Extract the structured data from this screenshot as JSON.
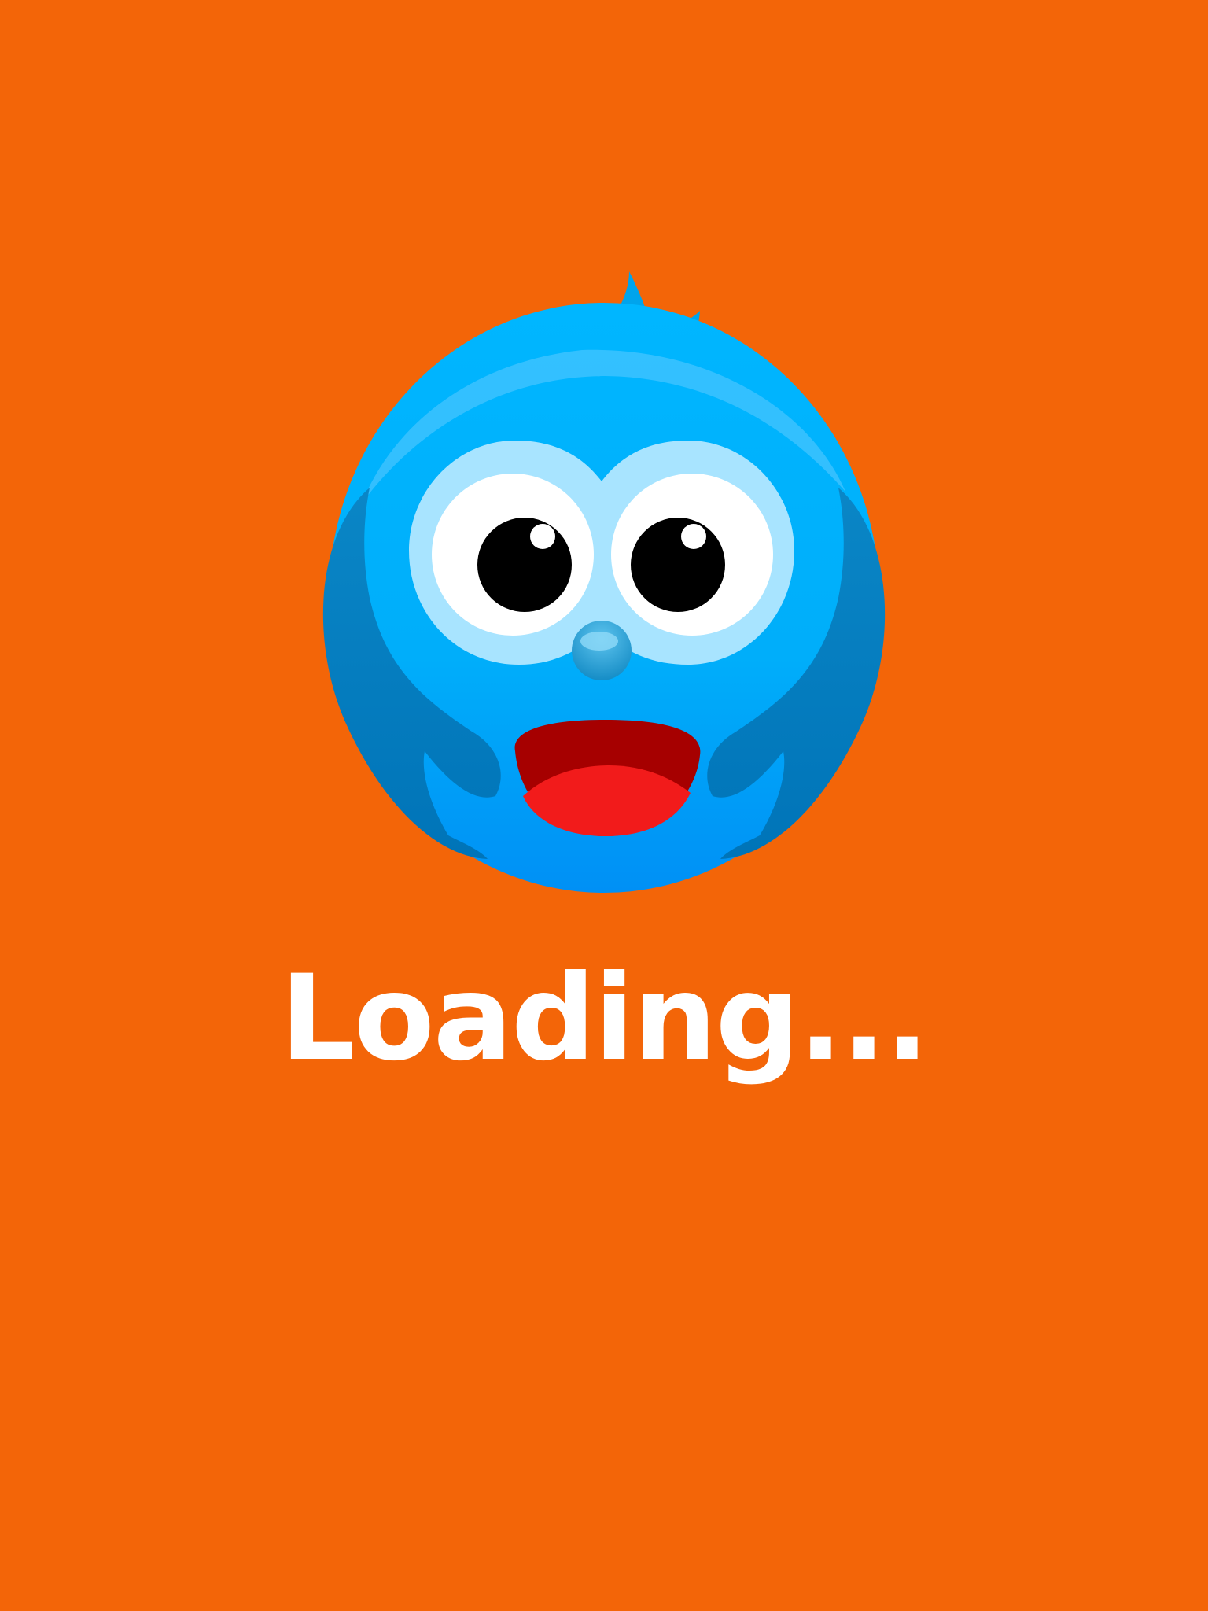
{
  "screen": {
    "background_color": "#F36508",
    "mascot_icon": "blue-bird-mascot-icon",
    "loading_text": "Loading...",
    "text_color": "#FFFFFF"
  }
}
